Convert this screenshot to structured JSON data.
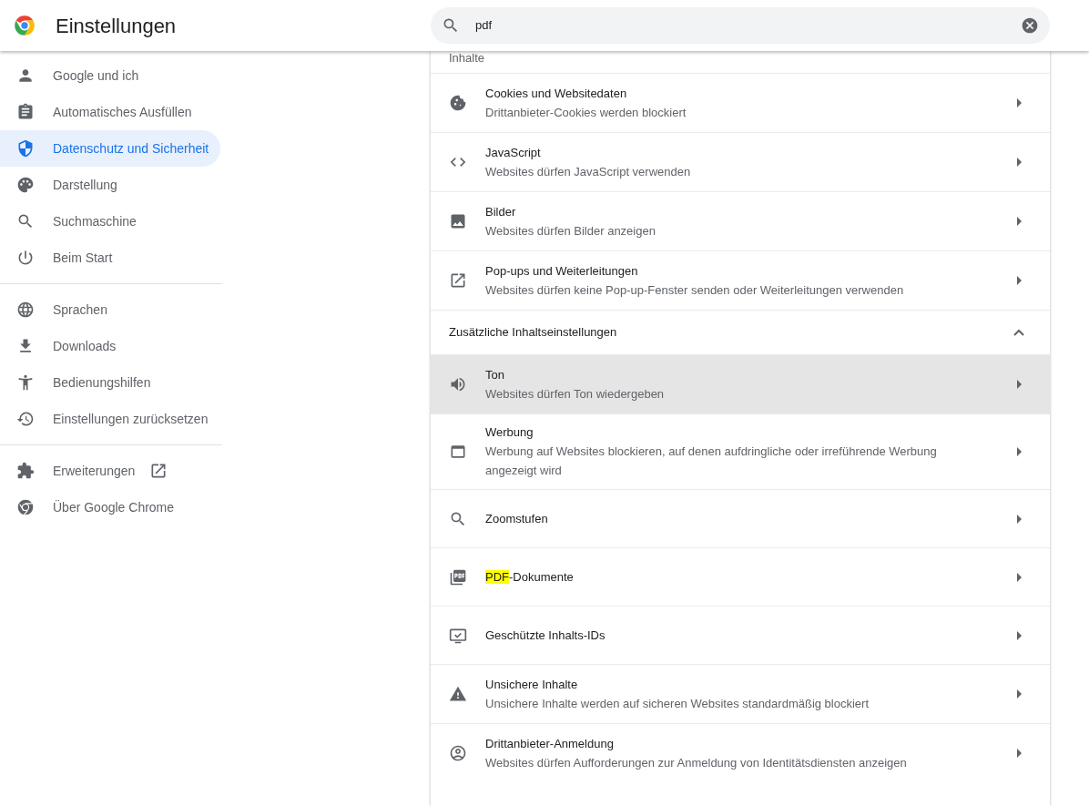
{
  "header": {
    "title": "Einstellungen",
    "search": {
      "value": "pdf"
    }
  },
  "sidebar": {
    "groups": [
      [
        {
          "label": "Google und ich",
          "selected": false
        },
        {
          "label": "Automatisches Ausfüllen",
          "selected": false
        },
        {
          "label": "Datenschutz und Sicherheit",
          "selected": true
        },
        {
          "label": "Darstellung",
          "selected": false
        },
        {
          "label": "Suchmaschine",
          "selected": false
        },
        {
          "label": "Beim Start",
          "selected": false
        }
      ],
      [
        {
          "label": "Sprachen",
          "selected": false
        },
        {
          "label": "Downloads",
          "selected": false
        },
        {
          "label": "Bedienungshilfen",
          "selected": false
        },
        {
          "label": "Einstellungen zurücksetzen",
          "selected": false
        }
      ],
      [
        {
          "label": "Erweiterungen",
          "selected": false
        },
        {
          "label": "Über Google Chrome",
          "selected": false
        }
      ]
    ]
  },
  "content": {
    "section_label": "Inhalte",
    "rows": [
      {
        "title": [
          {
            "text": "Cookies und Websitedaten",
            "match": false
          }
        ],
        "subtitle": "Drittanbieter-Cookies werden blockiert",
        "highlighted": false
      },
      {
        "title": [
          {
            "text": "JavaScript",
            "match": false
          }
        ],
        "subtitle": "Websites dürfen JavaScript verwenden",
        "highlighted": false
      },
      {
        "title": [
          {
            "text": "Bilder",
            "match": false
          }
        ],
        "subtitle": "Websites dürfen Bilder anzeigen",
        "highlighted": false
      },
      {
        "title": [
          {
            "text": "Pop-ups und Weiterleitungen",
            "match": false
          }
        ],
        "subtitle": "Websites dürfen keine Pop-up-Fenster senden oder Weiterleitungen verwenden",
        "highlighted": false
      }
    ],
    "additional": {
      "title": "Zusätzliche Inhaltseinstellungen",
      "expanded": true,
      "rows": [
        {
          "title": [
            {
              "text": "Ton",
              "match": false
            }
          ],
          "subtitle": "Websites dürfen Ton wiedergeben",
          "highlighted": true
        },
        {
          "title": [
            {
              "text": "Werbung",
              "match": false
            }
          ],
          "subtitle": "Werbung auf Websites blockieren, auf denen aufdringliche oder irreführende Werbung angezeigt wird",
          "highlighted": false
        },
        {
          "title": [
            {
              "text": "Zoomstufen",
              "match": false
            }
          ],
          "highlighted": false
        },
        {
          "title": [
            {
              "text": "PDF",
              "match": true
            },
            {
              "text": "-Dokumente",
              "match": false
            }
          ],
          "highlighted": false
        },
        {
          "title": [
            {
              "text": "Geschützte Inhalts-IDs",
              "match": false
            }
          ],
          "highlighted": false
        },
        {
          "title": [
            {
              "text": "Unsichere Inhalte",
              "match": false
            }
          ],
          "subtitle": "Unsichere Inhalte werden auf sicheren Websites standardmäßig blockiert",
          "highlighted": false
        },
        {
          "title": [
            {
              "text": "Drittanbieter-Anmeldung",
              "match": false
            }
          ],
          "subtitle": "Websites dürfen Aufforderungen zur Anmeldung von Identitätsdiensten anzeigen",
          "highlighted": false
        }
      ]
    }
  }
}
